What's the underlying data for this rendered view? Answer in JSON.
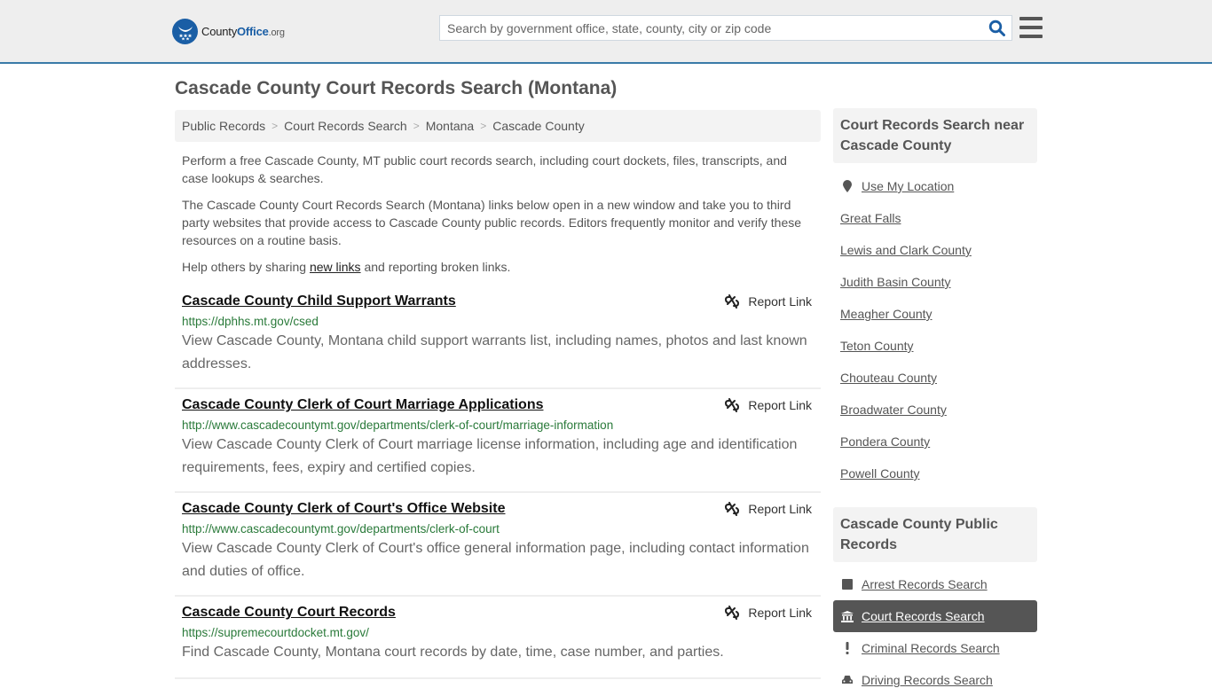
{
  "header": {
    "logo": {
      "part1": "County",
      "part2": "Office",
      "part3": ".org"
    },
    "search_placeholder": "Search by government office, state, county, city or zip code"
  },
  "page_title": "Cascade County Court Records Search (Montana)",
  "breadcrumb": [
    "Public Records",
    "Court Records Search",
    "Montana",
    "Cascade County"
  ],
  "intro": {
    "p1": "Perform a free Cascade County, MT public court records search, including court dockets, files, transcripts, and case lookups & searches.",
    "p2": "The Cascade County Court Records Search (Montana) links below open in a new window and take you to third party websites that provide access to Cascade County public records. Editors frequently monitor and verify these resources on a routine basis.",
    "p3_before": "Help others by sharing ",
    "p3_link": "new links",
    "p3_after": " and reporting broken links."
  },
  "report_label": "Report Link",
  "results": [
    {
      "title": "Cascade County Child Support Warrants",
      "url": "https://dphhs.mt.gov/csed",
      "desc": "View Cascade County, Montana child support warrants list, including names, photos and last known addresses."
    },
    {
      "title": "Cascade County Clerk of Court Marriage Applications",
      "url": "http://www.cascadecountymt.gov/departments/clerk-of-court/marriage-information",
      "desc": "View Cascade County Clerk of Court marriage license information, including age and identification requirements, fees, expiry and certified copies."
    },
    {
      "title": "Cascade County Clerk of Court's Office Website",
      "url": "http://www.cascadecountymt.gov/departments/clerk-of-court",
      "desc": "View Cascade County Clerk of Court's office general information page, including contact information and duties of office."
    },
    {
      "title": "Cascade County Court Records",
      "url": "https://supremecourtdocket.mt.gov/",
      "desc": "Find Cascade County, Montana court records by date, time, case number, and parties."
    }
  ],
  "sidebar": {
    "nearby_title": "Court Records Search near Cascade County",
    "use_location": "Use My Location",
    "nearby": [
      "Great Falls",
      "Lewis and Clark County",
      "Judith Basin County",
      "Meagher County",
      "Teton County",
      "Chouteau County",
      "Broadwater County",
      "Pondera County",
      "Powell County"
    ],
    "public_title": "Cascade County Public Records",
    "public": [
      {
        "label": "Arrest Records Search",
        "icon": "square-icon",
        "active": false
      },
      {
        "label": "Court Records Search",
        "icon": "courthouse-icon",
        "active": true
      },
      {
        "label": "Criminal Records Search",
        "icon": "exclamation-icon",
        "active": false
      },
      {
        "label": "Driving Records Search",
        "icon": "car-icon",
        "active": false
      }
    ]
  },
  "colors": {
    "brand": "#1a5ea5",
    "url_green": "#2a7a3a",
    "header_border": "#3a7aa8",
    "active_bg": "#555555"
  }
}
